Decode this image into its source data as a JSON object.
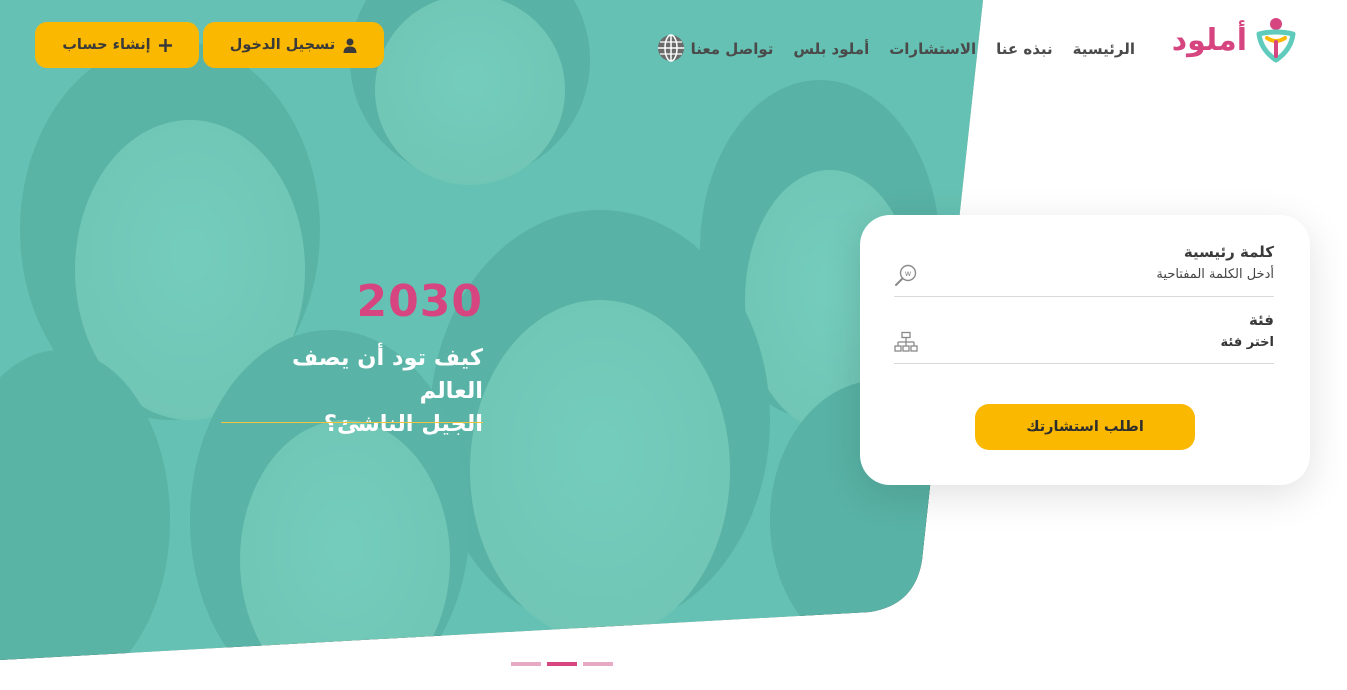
{
  "brand": {
    "name": "أملود",
    "pink": "#d6457f",
    "teal": "#5fcbbd",
    "yellow": "#fbb800"
  },
  "nav": {
    "items": [
      {
        "label": "الرئيسية"
      },
      {
        "label": "نبذه عنا"
      },
      {
        "label": "الاستشارات"
      },
      {
        "label": "أملود بلس"
      },
      {
        "label": "تواصل معنا"
      }
    ],
    "language_icon": "globe-icon"
  },
  "auth": {
    "login_label": "تسجيل الدخول",
    "login_icon": "user-icon",
    "signup_label": "إنشاء حساب",
    "signup_icon": "plus-icon"
  },
  "hero": {
    "year": "2030",
    "tagline_line1": "كيف تود أن يصف العالم",
    "tagline_line2": "الجيل الناشئ؟"
  },
  "search": {
    "keyword_label": "كلمة رئيسية",
    "keyword_placeholder": "أدخل الكلمة المفتاحية",
    "keyword_icon": "keyword-search-icon",
    "category_label": "فئة",
    "category_value": "اختر فئة",
    "category_icon": "hierarchy-icon",
    "submit_label": "اطلب استشارتك"
  },
  "slider": {
    "count": 3,
    "active_index": 1
  }
}
